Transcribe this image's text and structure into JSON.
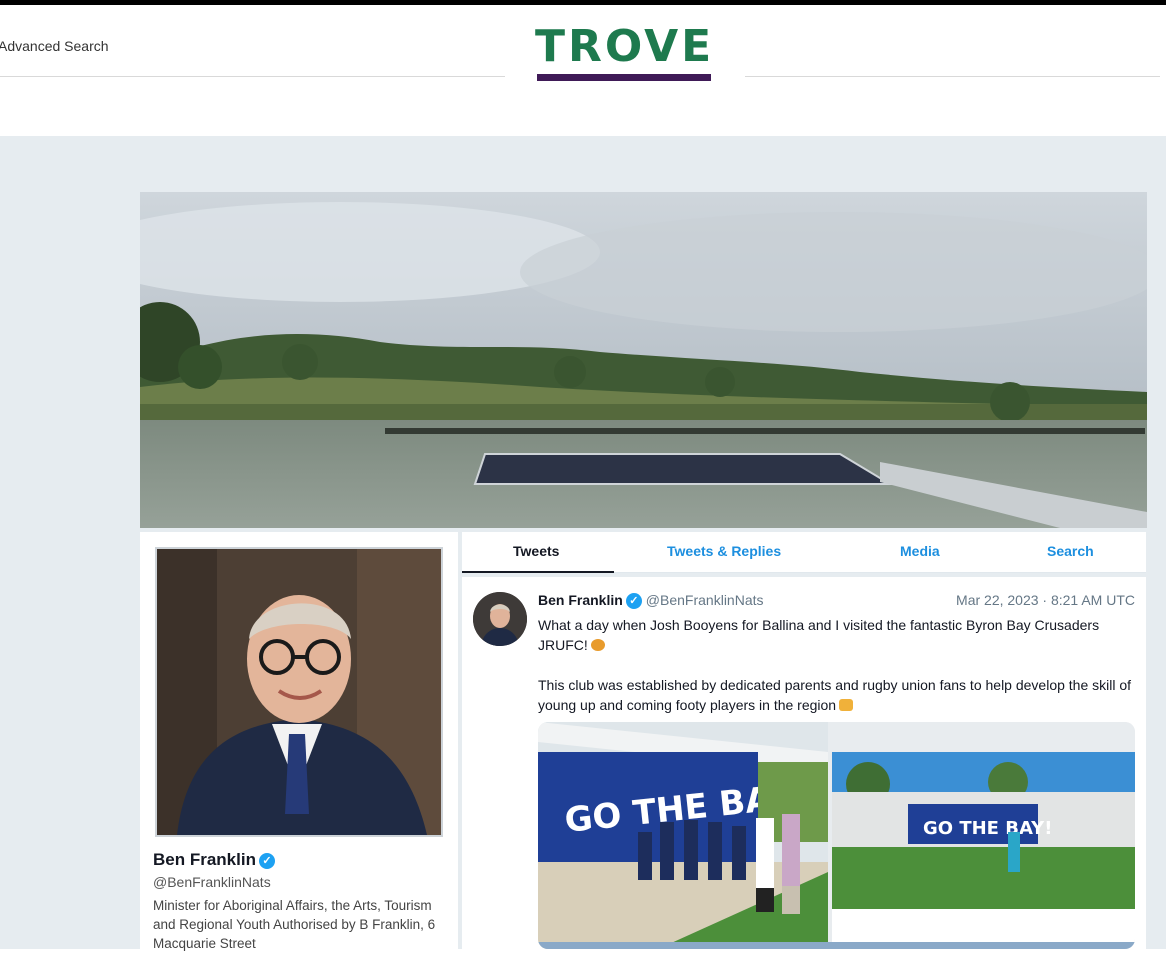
{
  "header": {
    "advanced_search": "Advanced Search",
    "logo_text": "TROVE",
    "brand_green": "#1e7a4e",
    "brand_purple": "#3f1a57"
  },
  "profile": {
    "name": "Ben Franklin",
    "handle": "@BenFranklinNats",
    "bio": "Minister for Aboriginal Affairs, the Arts, Tourism and Regional Youth Authorised by B Franklin, 6 Macquarie Street",
    "verified_icon": "verified-badge-icon"
  },
  "tabs": [
    {
      "label": "Tweets",
      "active": true
    },
    {
      "label": "Tweets & Replies",
      "active": false
    },
    {
      "label": "Media",
      "active": false
    },
    {
      "label": "Search",
      "active": false
    }
  ],
  "tweet": {
    "author": "Ben Franklin",
    "handle": "@BenFranklinNats",
    "date": "Mar 22, 2023 · 8:21 AM UTC",
    "text_p1": "What a day when Josh Booyens for Ballina and I visited the fantastic Byron Bay Crusaders JRUFC!",
    "text_p2": "This club was established by dedicated parents and rugby union fans to help develop the skill of young up and coming footy players in the region",
    "mural_text": "GO THE BAY!"
  },
  "colors": {
    "link_blue": "#1d8fdf",
    "page_grey": "#e6ecf0"
  }
}
